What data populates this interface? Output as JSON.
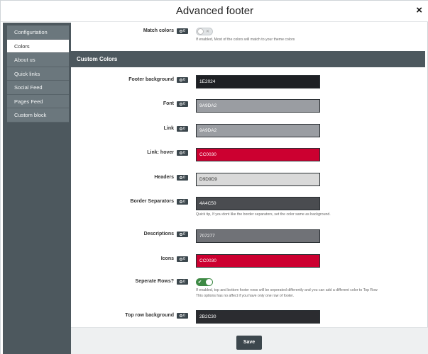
{
  "window": {
    "title": "Advanced footer",
    "close_glyph": "×"
  },
  "sidebar": {
    "items": [
      {
        "label": "Configurtation",
        "active": false
      },
      {
        "label": "Colors",
        "active": true
      },
      {
        "label": "About us",
        "active": false
      },
      {
        "label": "Quick links",
        "active": false
      },
      {
        "label": "Social Feed",
        "active": false
      },
      {
        "label": "Pages Feed",
        "active": false
      },
      {
        "label": "Custom block",
        "active": false
      }
    ]
  },
  "badge_text": "0",
  "match_colors": {
    "label": "Match colors",
    "toggle_mark": "✕",
    "enabled": false,
    "help": "If enabled, Most of the colors will match to your theme colors"
  },
  "section": {
    "title": "Custom Colors"
  },
  "colors": {
    "footer_background": {
      "label": "Footer background",
      "value": "1E2024",
      "bg": "#1e2024",
      "fg": "#ffffff"
    },
    "font": {
      "label": "Font",
      "value": "9A9DA2",
      "bg": "#9a9da2",
      "fg": "#ffffff"
    },
    "link": {
      "label": "Link",
      "value": "9A9DA2",
      "bg": "#9a9da2",
      "fg": "#ffffff"
    },
    "link_hover": {
      "label": "Link: hover",
      "value": "CC0030",
      "bg": "#cc0030",
      "fg": "#ffffff"
    },
    "headers": {
      "label": "Headers",
      "value": "D9D9D9",
      "bg": "#d9d9d9",
      "fg": "#333333"
    },
    "border_separators": {
      "label": "Border Separators",
      "value": "4A4C50",
      "bg": "#4a4c50",
      "fg": "#ffffff",
      "help": "Quick tip, If you dont like the border separators, set the color same as background."
    },
    "descriptions": {
      "label": "Descriptions",
      "value": "707277",
      "bg": "#707277",
      "fg": "#ffffff"
    },
    "icons": {
      "label": "Icons",
      "value": "CC0030",
      "bg": "#cc0030",
      "fg": "#ffffff"
    },
    "top_row_background": {
      "label": "Top row background",
      "value": "2B2C30",
      "bg": "#2b2c30",
      "fg": "#ffffff"
    }
  },
  "separate_rows": {
    "label": "Seperate Rows?",
    "toggle_mark": "✔",
    "enabled": true,
    "help_line1": "If enabled, top and bottom footer rows will be seperated differently and you can add a different color to Top Row",
    "help_line2": "This options has no affect if you have only one row of footer."
  },
  "footer": {
    "save_label": "Save"
  }
}
